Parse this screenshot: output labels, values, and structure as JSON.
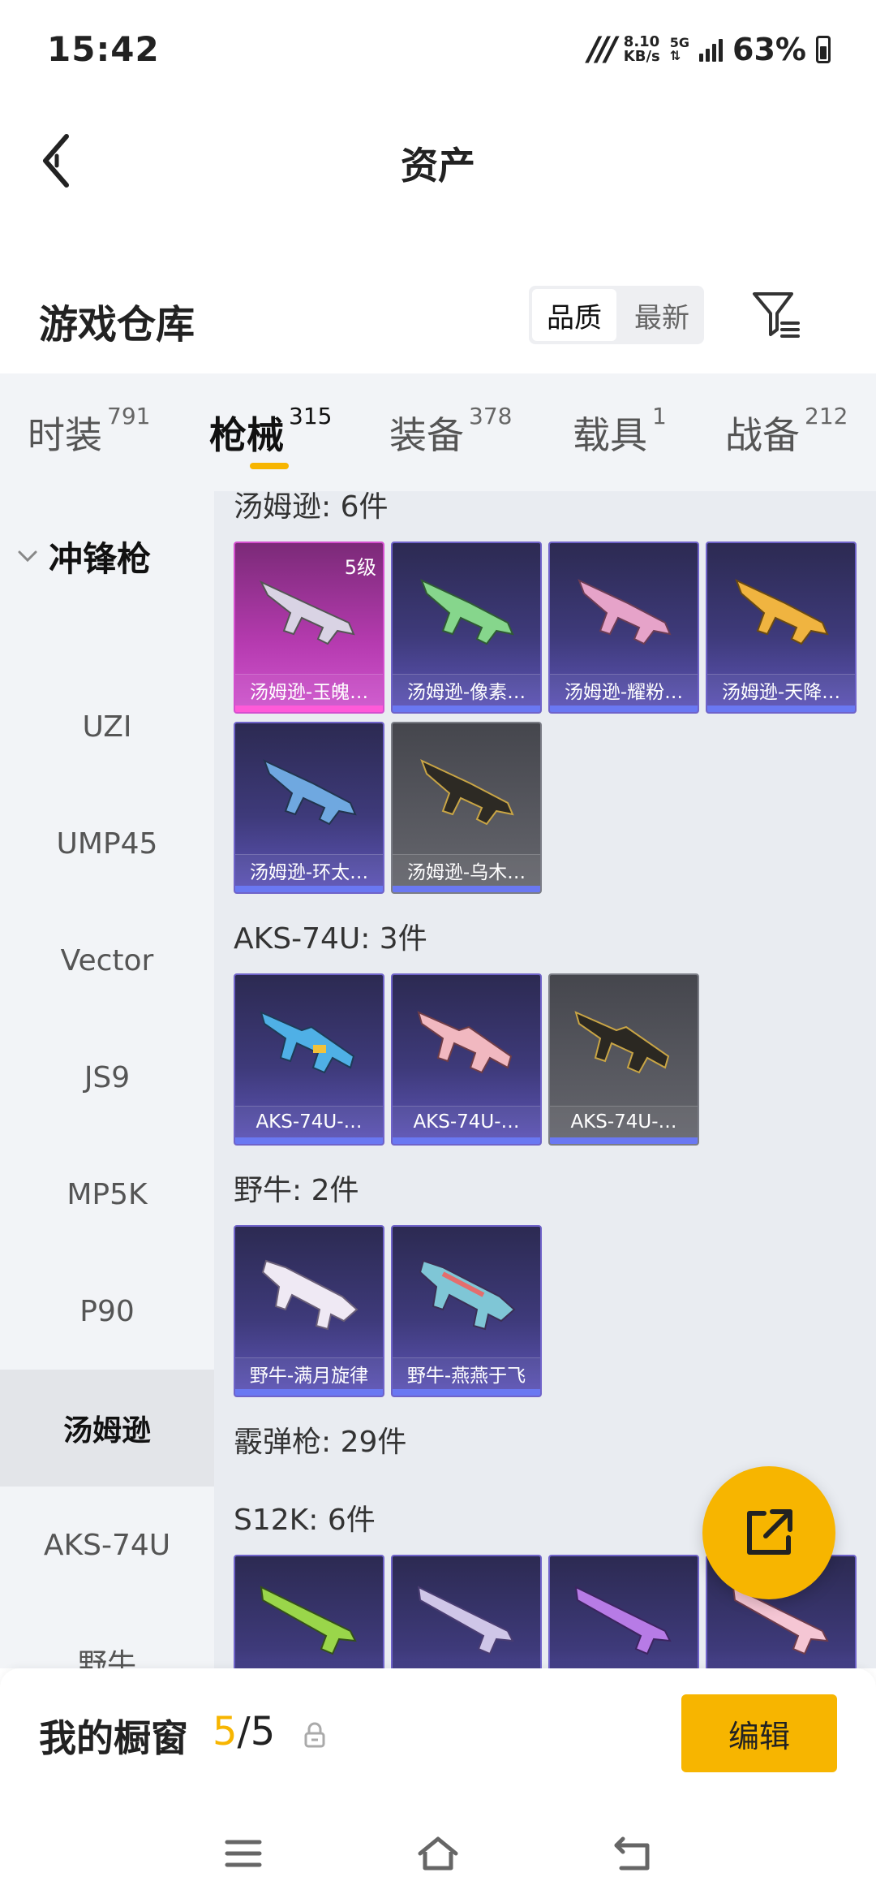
{
  "status_bar": {
    "time": "15:42",
    "net_speed_value": "8.10",
    "net_speed_unit": "KB/s",
    "network_type": "5G",
    "battery": "63%"
  },
  "header": {
    "title": "资产"
  },
  "toolbar": {
    "warehouse_title": "游戏仓库",
    "sort_options": [
      "品质",
      "最新"
    ],
    "sort_selected": "品质"
  },
  "tabs": [
    {
      "label": "时装",
      "count": "791"
    },
    {
      "label": "枪械",
      "count": "315",
      "active": true
    },
    {
      "label": "装备",
      "count": "378"
    },
    {
      "label": "载具",
      "count": "1"
    },
    {
      "label": "战备",
      "count": "212"
    }
  ],
  "sidebar": {
    "group": "冲锋枪",
    "items": [
      "UZI",
      "UMP45",
      "Vector",
      "JS9",
      "MP5K",
      "P90",
      "汤姆逊",
      "AKS-74U",
      "野牛"
    ],
    "active": "汤姆逊"
  },
  "sections": [
    {
      "title": "汤姆逊: 6件",
      "cards": [
        {
          "name": "汤姆逊-玉魄…",
          "rarity": "pink",
          "level": "5级"
        },
        {
          "name": "汤姆逊-像素…",
          "rarity": "purple"
        },
        {
          "name": "汤姆逊-耀粉…",
          "rarity": "purple"
        },
        {
          "name": "汤姆逊-天降…",
          "rarity": "purple"
        },
        {
          "name": "汤姆逊-环太…",
          "rarity": "purple"
        },
        {
          "name": "汤姆逊-乌木…",
          "rarity": "gray"
        }
      ]
    },
    {
      "title": "AKS-74U: 3件",
      "cards": [
        {
          "name": "AKS-74U-…",
          "rarity": "purple"
        },
        {
          "name": "AKS-74U-…",
          "rarity": "purple"
        },
        {
          "name": "AKS-74U-…",
          "rarity": "gray"
        }
      ]
    },
    {
      "title": "野牛: 2件",
      "cards": [
        {
          "name": "野牛-满月旋律",
          "rarity": "purple"
        },
        {
          "name": "野牛-燕燕于飞",
          "rarity": "purple"
        }
      ]
    },
    {
      "title": "霰弹枪: 29件",
      "cards": []
    },
    {
      "title": "S12K: 6件",
      "cards": [
        {
          "name": "",
          "rarity": "purple"
        },
        {
          "name": "",
          "rarity": "purple"
        },
        {
          "name": "",
          "rarity": "purple"
        },
        {
          "name": "",
          "rarity": "purple"
        }
      ]
    }
  ],
  "bottom_bar": {
    "label": "我的橱窗",
    "current": "5",
    "separator": "/",
    "total": "5",
    "edit_label": "编辑"
  },
  "colors": {
    "accent": "#f7b500",
    "rarity_purple": "#6f63c9",
    "rarity_pink": "#d44fcf",
    "rarity_gray": "#7b7d86"
  }
}
